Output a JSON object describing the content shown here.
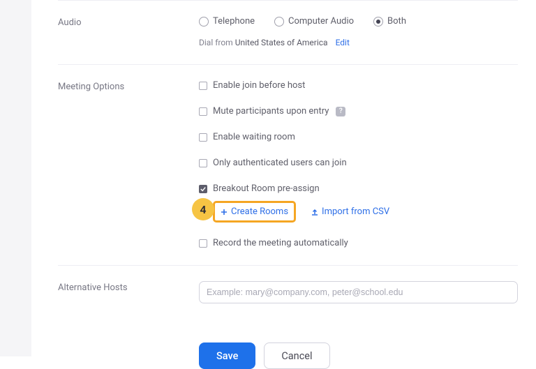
{
  "audio": {
    "section_label": "Audio",
    "options": {
      "telephone": "Telephone",
      "computer": "Computer Audio",
      "both": "Both"
    },
    "selected": "both",
    "dial_prefix": "Dial from",
    "dial_region": "United States of America",
    "edit_label": "Edit"
  },
  "meeting": {
    "section_label": "Meeting Options",
    "join_before": {
      "label": "Enable join before host",
      "checked": false
    },
    "mute_entry": {
      "label": "Mute participants upon entry",
      "checked": false
    },
    "waiting": {
      "label": "Enable waiting room",
      "checked": false
    },
    "auth_only": {
      "label": "Only authenticated users can join",
      "checked": false
    },
    "breakout": {
      "label": "Breakout Room pre-assign",
      "checked": true
    },
    "create_rooms_label": "Create Rooms",
    "import_csv_label": "Import from CSV",
    "record_auto": {
      "label": "Record the meeting automatically",
      "checked": false
    }
  },
  "alt_hosts": {
    "section_label": "Alternative Hosts",
    "placeholder": "Example: mary@company.com, peter@school.edu",
    "value": ""
  },
  "buttons": {
    "save": "Save",
    "cancel": "Cancel"
  },
  "annotation": {
    "step": "4"
  },
  "colors": {
    "link": "#2e6fe7",
    "primary": "#1e71ea",
    "highlight": "#f5a623",
    "badge": "#f6c444"
  }
}
